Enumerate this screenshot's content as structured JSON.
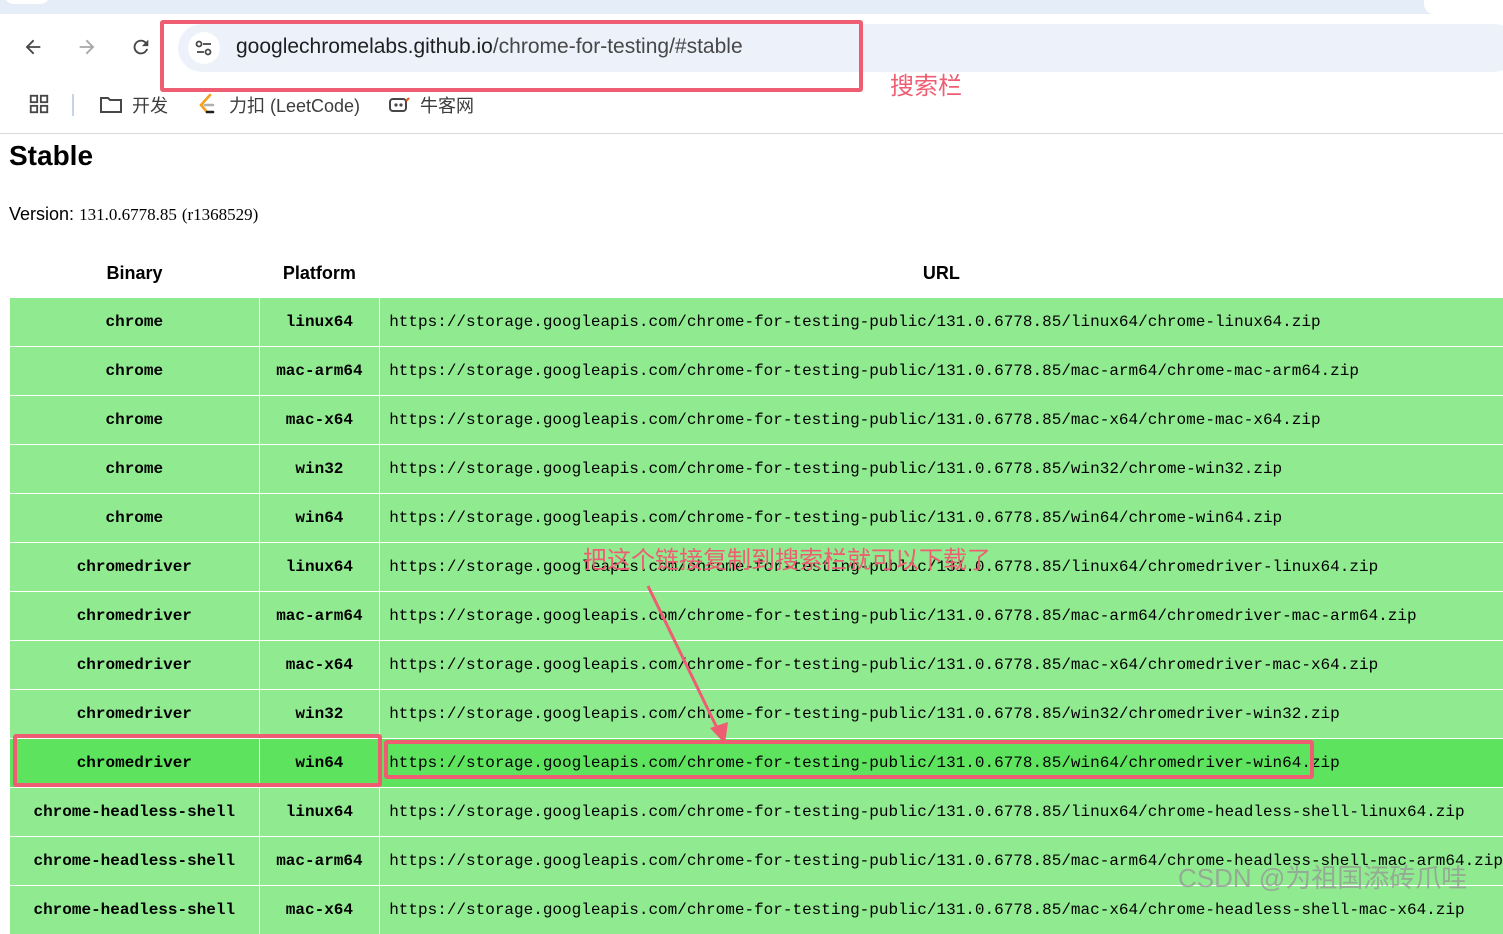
{
  "browser": {
    "url_host": "googlechromelabs.github.io",
    "url_path": "/chrome-for-testing/#stable",
    "bookmarks": [
      {
        "label": "开发",
        "icon": "folder-icon"
      },
      {
        "label": "力扣 (LeetCode)",
        "icon": "leetcode-icon"
      },
      {
        "label": "牛客网",
        "icon": "nowcoder-icon"
      }
    ]
  },
  "page": {
    "title": "Stable",
    "version_label": "Version:",
    "version_value": "131.0.6778.85",
    "revision": "(r1368529)"
  },
  "table": {
    "headers": [
      "Binary",
      "Platform",
      "URL"
    ],
    "rows": [
      {
        "binary": "chrome",
        "platform": "linux64",
        "url": "https://storage.googleapis.com/chrome-for-testing-public/131.0.6778.85/linux64/chrome-linux64.zip"
      },
      {
        "binary": "chrome",
        "platform": "mac-arm64",
        "url": "https://storage.googleapis.com/chrome-for-testing-public/131.0.6778.85/mac-arm64/chrome-mac-arm64.zip"
      },
      {
        "binary": "chrome",
        "platform": "mac-x64",
        "url": "https://storage.googleapis.com/chrome-for-testing-public/131.0.6778.85/mac-x64/chrome-mac-x64.zip"
      },
      {
        "binary": "chrome",
        "platform": "win32",
        "url": "https://storage.googleapis.com/chrome-for-testing-public/131.0.6778.85/win32/chrome-win32.zip"
      },
      {
        "binary": "chrome",
        "platform": "win64",
        "url": "https://storage.googleapis.com/chrome-for-testing-public/131.0.6778.85/win64/chrome-win64.zip"
      },
      {
        "binary": "chromedriver",
        "platform": "linux64",
        "url": "https://storage.googleapis.com/chrome-for-testing-public/131.0.6778.85/linux64/chromedriver-linux64.zip"
      },
      {
        "binary": "chromedriver",
        "platform": "mac-arm64",
        "url": "https://storage.googleapis.com/chrome-for-testing-public/131.0.6778.85/mac-arm64/chromedriver-mac-arm64.zip"
      },
      {
        "binary": "chromedriver",
        "platform": "mac-x64",
        "url": "https://storage.googleapis.com/chrome-for-testing-public/131.0.6778.85/mac-x64/chromedriver-mac-x64.zip"
      },
      {
        "binary": "chromedriver",
        "platform": "win32",
        "url": "https://storage.googleapis.com/chrome-for-testing-public/131.0.6778.85/win32/chromedriver-win32.zip"
      },
      {
        "binary": "chromedriver",
        "platform": "win64",
        "url": "https://storage.googleapis.com/chrome-for-testing-public/131.0.6778.85/win64/chromedriver-win64.zip",
        "highlighted": true
      },
      {
        "binary": "chrome-headless-shell",
        "platform": "linux64",
        "url": "https://storage.googleapis.com/chrome-for-testing-public/131.0.6778.85/linux64/chrome-headless-shell-linux64.zip"
      },
      {
        "binary": "chrome-headless-shell",
        "platform": "mac-arm64",
        "url": "https://storage.googleapis.com/chrome-for-testing-public/131.0.6778.85/mac-arm64/chrome-headless-shell-mac-arm64.zip"
      },
      {
        "binary": "chrome-headless-shell",
        "platform": "mac-x64",
        "url": "https://storage.googleapis.com/chrome-for-testing-public/131.0.6778.85/mac-x64/chrome-headless-shell-mac-x64.zip"
      }
    ]
  },
  "annotations": {
    "search_bar_label": "搜索栏",
    "instruction": "把这个链接复制到搜索栏就可以下载了",
    "watermark": "CSDN @为祖国添砖爪哇"
  },
  "colors": {
    "row_bg": "#90ea90",
    "row_highlight_bg": "#5ee35e",
    "annotation_red": "#ef5d73",
    "omnibox_bg": "#edf2fa"
  }
}
